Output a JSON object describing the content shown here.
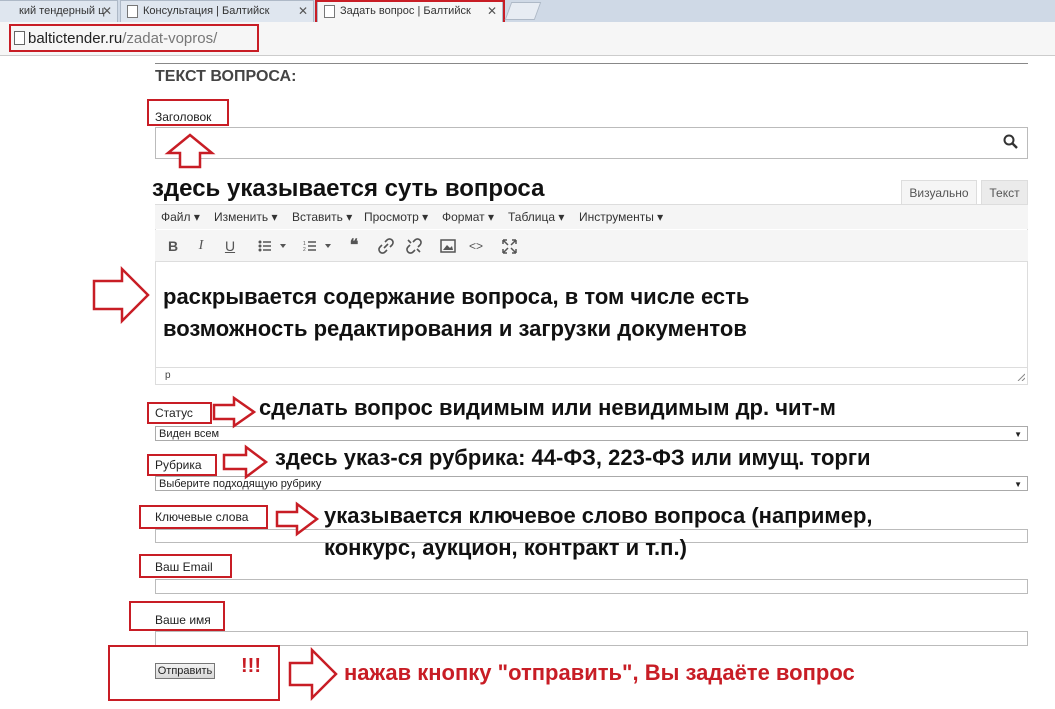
{
  "browser": {
    "tabs": [
      {
        "label": "кий тендерный ц"
      },
      {
        "label": "Консультация | Балтийск"
      },
      {
        "label": "Задать вопрос | Балтийск"
      }
    ],
    "close_glyph": "✕",
    "url_host": "baltictender.ru",
    "url_path": "/zadat-vopros/"
  },
  "form": {
    "heading": "ТЕКСТ ВОПРОСА:",
    "title_label": "Заголовок",
    "editor": {
      "tab_visual": "Визуально",
      "tab_text": "Текст",
      "menus": [
        "Файл ▾",
        "Изменить ▾",
        "Вставить ▾",
        "Просмотр ▾",
        "Формат ▾",
        "Таблица ▾",
        "Инструменты ▾"
      ],
      "toolbar": {
        "bold": "B",
        "italic": "I",
        "underline": "U",
        "quote": "❝",
        "code": "<>"
      },
      "status_path": "p"
    },
    "status_label": "Статус",
    "status_value": "Виден всем",
    "rubric_label": "Рубрика",
    "rubric_value": "Выберите подходящую рубрику",
    "keywords_label": "Ключевые слова",
    "email_label": "Ваш Email",
    "name_label": "Ваше имя",
    "submit_label": "Отправить"
  },
  "annotations": {
    "title_hint": "здесь указывается суть вопроса",
    "editor_hint_1": "раскрывается содержание вопроса, в том числе есть",
    "editor_hint_2": "возможность редактирования и загрузки документов",
    "status_hint": "сделать вопрос видимым или невидимым др. чит-м",
    "rubric_hint": "здесь указ-ся рубрика: 44-ФЗ, 223-ФЗ или имущ. торги",
    "keywords_hint_1": "указывается ключевое слово вопроса (например,",
    "keywords_hint_2": "конкурс, аукцион, контракт и т.п.)",
    "exclaim": "!!!",
    "submit_hint": "нажав кнопку \"отправить\", Вы задаёте вопрос"
  },
  "colors": {
    "annotation_red": "#c81d25"
  },
  "icons": [
    "search-icon",
    "bullet-list-icon",
    "numbered-list-icon",
    "link-icon",
    "unlink-icon",
    "image-icon",
    "fullscreen-icon",
    "resize-handle-icon",
    "page-icon"
  ]
}
